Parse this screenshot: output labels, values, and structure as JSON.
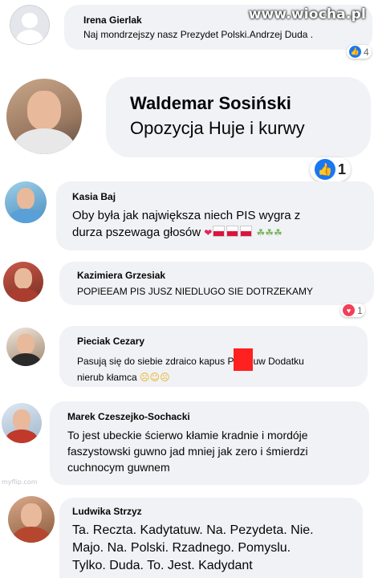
{
  "watermark": "www.wiocha.pl",
  "watermark2": "myflip.com",
  "comments": [
    {
      "name": "Irena Gierlak",
      "text": "Naj mondrzejszy nasz Prezydet Polski.Andrzej  Duda .",
      "reaction_count": "4"
    },
    {
      "name": "Waldemar Sosiński",
      "text": "Opozycja Huje i kurwy",
      "reaction_count": "1"
    },
    {
      "name": "Kasia Baj",
      "text_line1": "Oby była jak największa  niech  PIS  wygra  z",
      "text_line2": "durza pszewaga głosów"
    },
    {
      "name": "Kazimiera Grzesiak",
      "text": "POPIEEAM  PIS  JUSZ  NIEDLUGO  SIE  DOTRZEKAMY",
      "reaction_count": "1"
    },
    {
      "name": "Pieciak Cezary",
      "text_part1": "Pasują  się do siebie zdraico kapus P",
      "text_part2": "uw Dodatku",
      "text_line2": "nierub kłamca"
    },
    {
      "name": "Marek Czeszejko-Sochacki",
      "text_line1": "To jest ubeckie ścierwo kłamie kradnie i mordóje",
      "text_line2": "faszystowski guwno jad mniej jak zero i śmierdzi",
      "text_line3": "cuchnocym guwnem"
    },
    {
      "name": "Ludwika Strzyz",
      "text_line1": "Ta. Reczta. Kadytatuw. Na. Pezydeta. Nie.",
      "text_line2": "Majo. Na. Polski. Rzadnego. Pomyslu.",
      "text_line3": "Tylko.  Duda. To. Jest. Kadydant"
    }
  ],
  "colors": {
    "like": "#1877f2",
    "love": "#f33e58",
    "bubble": "#f0f2f5"
  },
  "icons": [
    "like-icon",
    "love-icon",
    "default-avatar-icon"
  ]
}
